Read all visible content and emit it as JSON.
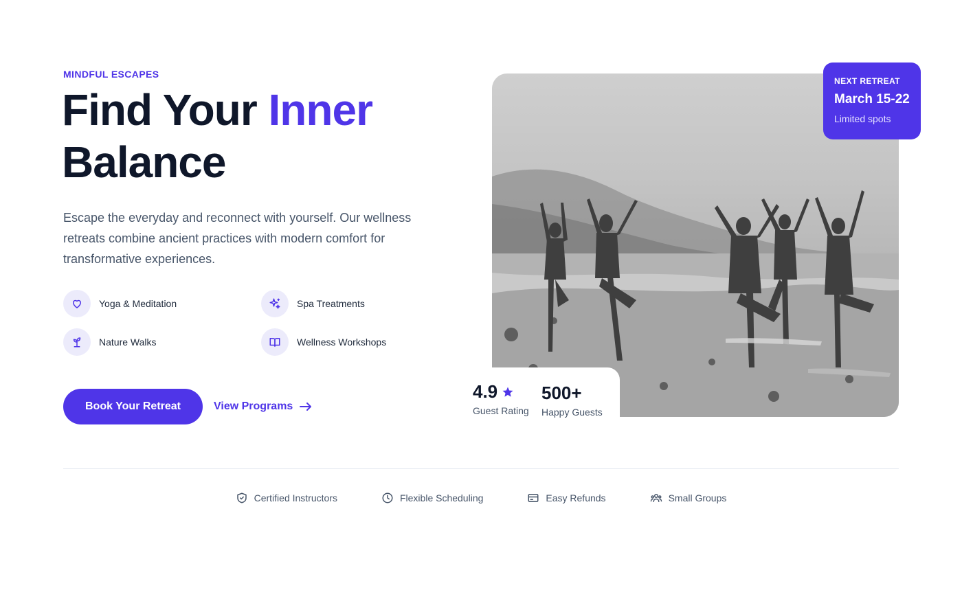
{
  "hero": {
    "eyebrow": "MINDFUL ESCAPES",
    "headline_part1": "Find Your ",
    "headline_accent": "Inner",
    "headline_part2": "Balance",
    "lead": "Escape the everyday and reconnect with yourself. Our wellness retreats combine ancient practices with modern comfort for transformative experiences."
  },
  "features": [
    {
      "label": "Yoga & Meditation",
      "icon": "heart-icon"
    },
    {
      "label": "Spa Treatments",
      "icon": "sparkles-icon"
    },
    {
      "label": "Nature Walks",
      "icon": "sprout-icon"
    },
    {
      "label": "Wellness Workshops",
      "icon": "book-open-icon"
    }
  ],
  "cta": {
    "primary": "Book Your Retreat",
    "secondary": "View Programs"
  },
  "next_retreat": {
    "label": "NEXT RETREAT",
    "dates": "March 15-22",
    "note": "Limited spots"
  },
  "stats": {
    "rating_value": "4.9",
    "rating_label": "Guest Rating",
    "guests_value": "500+",
    "guests_label": "Happy Guests"
  },
  "trust": [
    {
      "label": "Certified Instructors",
      "icon": "shield-check-icon"
    },
    {
      "label": "Flexible Scheduling",
      "icon": "clock-icon"
    },
    {
      "label": "Easy Refunds",
      "icon": "credit-card-icon"
    },
    {
      "label": "Small Groups",
      "icon": "users-icon"
    }
  ],
  "colors": {
    "accent": "#4f35e8",
    "heading": "#0f172a",
    "body_text": "#475569"
  }
}
